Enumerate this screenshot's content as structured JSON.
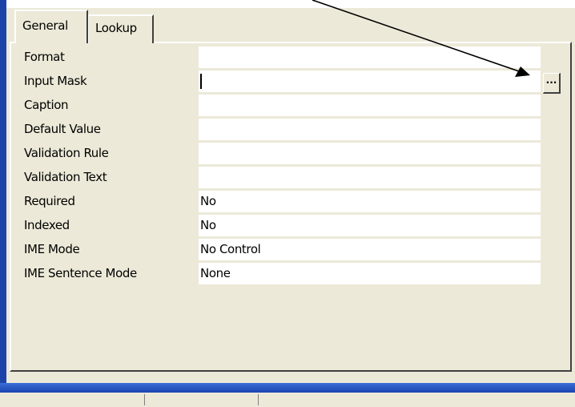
{
  "tabs": [
    {
      "label": "General",
      "selected": true
    },
    {
      "label": "Lookup",
      "selected": false
    }
  ],
  "properties": [
    {
      "label": "Format",
      "value": ""
    },
    {
      "label": "Input Mask",
      "value": ""
    },
    {
      "label": "Caption",
      "value": ""
    },
    {
      "label": "Default Value",
      "value": ""
    },
    {
      "label": "Validation Rule",
      "value": ""
    },
    {
      "label": "Validation Text",
      "value": ""
    },
    {
      "label": "Required",
      "value": "No"
    },
    {
      "label": "Indexed",
      "value": "No"
    },
    {
      "label": "IME Mode",
      "value": "No Control"
    },
    {
      "label": "IME Sentence Mode",
      "value": "None"
    }
  ],
  "builder_button": {
    "label": "..."
  },
  "colors": {
    "panel": "#ece9d8",
    "window_blue": "#1c44a8",
    "field": "#ffffff"
  },
  "annotation": {
    "icon": "arrow-pointing-to-builder-button"
  }
}
